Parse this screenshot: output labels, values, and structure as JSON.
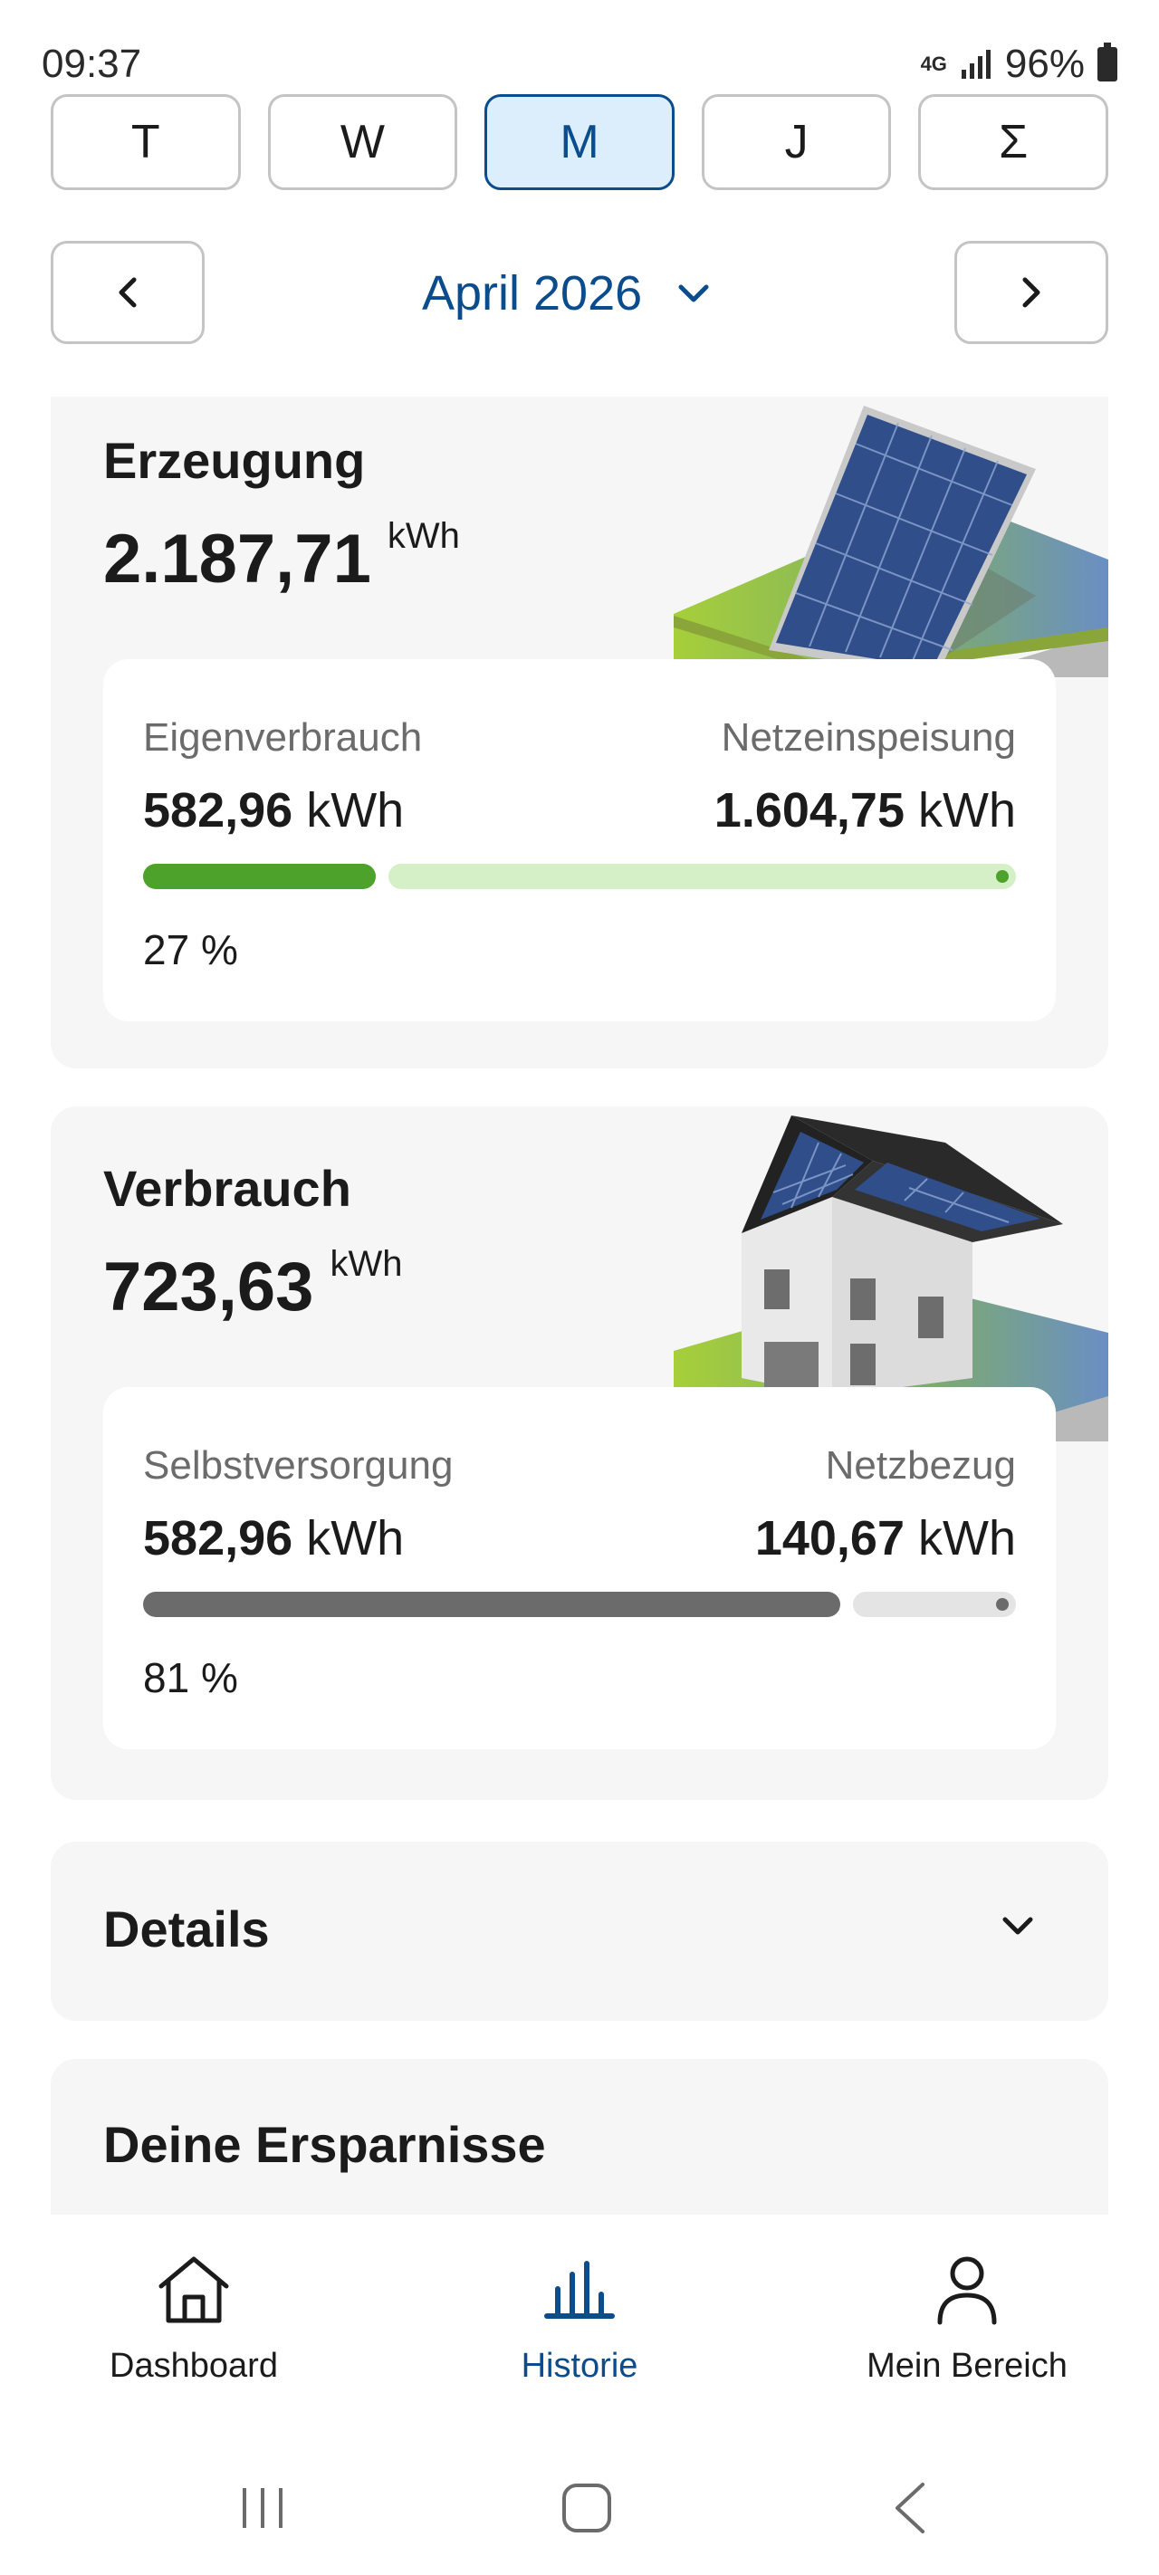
{
  "status_bar": {
    "time": "09:37",
    "network": "4G",
    "battery": "96%"
  },
  "period_tabs": [
    {
      "label": "T",
      "active": false
    },
    {
      "label": "W",
      "active": false
    },
    {
      "label": "M",
      "active": true
    },
    {
      "label": "J",
      "active": false
    },
    {
      "label": "Σ",
      "active": false
    }
  ],
  "date_nav": {
    "selected": "April 2026"
  },
  "generation": {
    "title": "Erzeugung",
    "value": "2.187,71",
    "unit": "kWh",
    "left_label": "Eigenverbrauch",
    "left_value": "582,96",
    "left_unit": "kWh",
    "right_label": "Netzeinspeisung",
    "right_value": "1.604,75",
    "right_unit": "kWh",
    "share": 0.27,
    "percent_text": "27 %",
    "bar_color": "#4ca22a",
    "bar_rest_color": "#d5efc6"
  },
  "consumption": {
    "title": "Verbrauch",
    "value": "723,63",
    "unit": "kWh",
    "left_label": "Selbstversorgung",
    "left_value": "582,96",
    "left_unit": "kWh",
    "right_label": "Netzbezug",
    "right_value": "140,67",
    "right_unit": "kWh",
    "share": 0.81,
    "percent_text": "81 %",
    "bar_color": "#6b6b6b",
    "bar_rest_color": "#e4e4e4"
  },
  "details": {
    "title": "Details"
  },
  "savings": {
    "title": "Deine Ersparnisse"
  },
  "bottom_nav": [
    {
      "label": "Dashboard",
      "icon": "home-icon",
      "active": false
    },
    {
      "label": "Historie",
      "icon": "bar-chart-icon",
      "active": true
    },
    {
      "label": "Mein Bereich",
      "icon": "person-icon",
      "active": false
    }
  ],
  "colors": {
    "accent": "#0b4c8c",
    "tab_active_bg": "#dceefc",
    "card_bg": "#f6f6f6"
  }
}
